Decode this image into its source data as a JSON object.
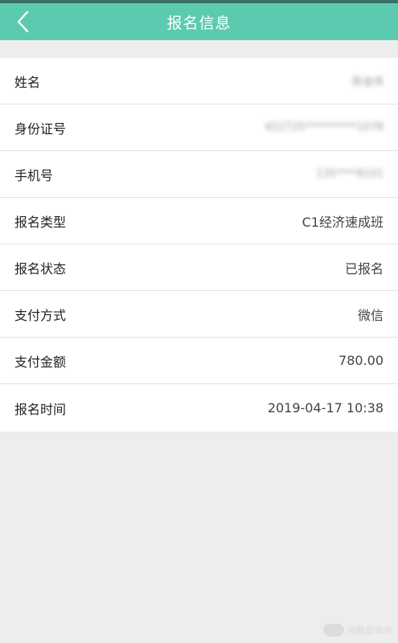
{
  "header": {
    "title": "报名信息",
    "back_icon": "chevron-left-icon"
  },
  "colors": {
    "header_bg": "#5ccab0",
    "page_bg": "#ededed",
    "row_bg": "#ffffff"
  },
  "rows": [
    {
      "label": "姓名",
      "value": "陈金伟"
    },
    {
      "label": "身份证号",
      "value": "422725**********1078"
    },
    {
      "label": "手机号",
      "value": "135****8101"
    },
    {
      "label": "报名类型",
      "value": "C1经济速成班"
    },
    {
      "label": "报名状态",
      "value": "已报名"
    },
    {
      "label": "支付方式",
      "value": "微信"
    },
    {
      "label": "支付金额",
      "value": "780.00"
    },
    {
      "label": "报名时间",
      "value": "2019-04-17 10:38"
    }
  ],
  "watermark": {
    "text": "阿酷安卓网"
  }
}
